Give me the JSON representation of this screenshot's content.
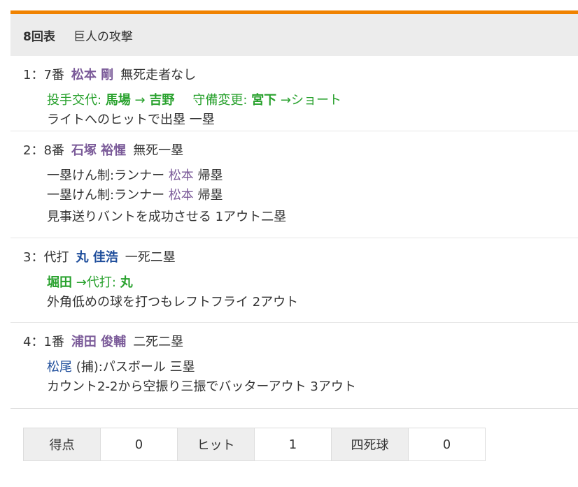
{
  "header": {
    "inning": "8回表",
    "side": "巨人の攻撃"
  },
  "plays": [
    {
      "num": "1：",
      "order": "7番",
      "batter": "松本 剛",
      "situation": "無死走者なし",
      "change1_label": "投手交代:",
      "change1_from": "馬場",
      "change1_arrow": "→",
      "change1_to": "吉野",
      "change2_label": "守備変更:",
      "change2_player": "宮下",
      "change2_pos": "→ショート",
      "result": "ライトへのヒットで出塁 一塁"
    },
    {
      "num": "2：",
      "order": "8番",
      "batter": "石塚 裕惺",
      "situation": "無死一塁",
      "event1_pre": "一塁けん制:ランナー",
      "event1_runner": "松本",
      "event1_post": "帰塁",
      "event2_pre": "一塁けん制:ランナー",
      "event2_runner": "松本",
      "event2_post": "帰塁",
      "result": "見事送りバントを成功させる 1アウト二塁"
    },
    {
      "num": "3：",
      "order": "代打",
      "batter": "丸 佳浩",
      "situation": "一死二塁",
      "change_player": "堀田",
      "change_label": "→代打:",
      "change_to": "丸",
      "result": "外角低めの球を打つもレフトフライ 2アウト"
    },
    {
      "num": "4：",
      "order": "1番",
      "batter": "浦田 俊輔",
      "situation": "二死二塁",
      "event_player": "松尾",
      "event_text": "(捕):パスボール 三塁",
      "result": "カウント2-2から空振り三振でバッターアウト 3アウト"
    }
  ],
  "stats": [
    {
      "label": "得点",
      "value": "0"
    },
    {
      "label": "ヒット",
      "value": "1"
    },
    {
      "label": "四死球",
      "value": "0"
    }
  ]
}
